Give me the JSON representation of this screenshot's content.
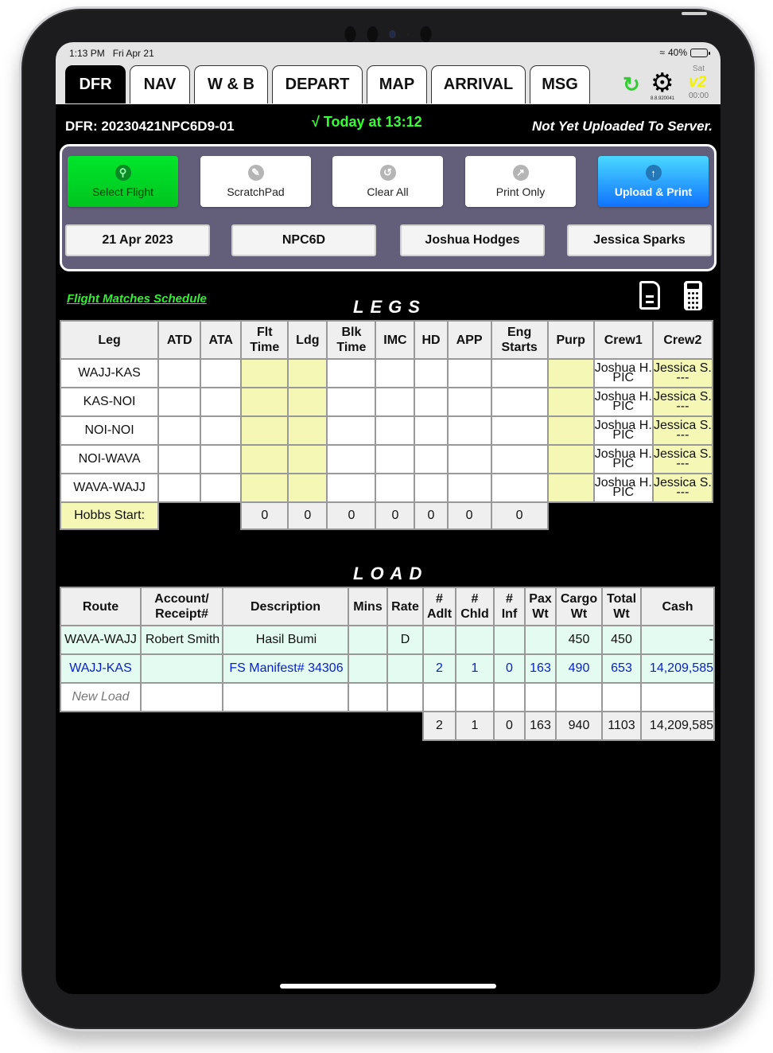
{
  "status_bar": {
    "time": "1:13 PM",
    "date": "Fri Apr 21",
    "battery": "40%",
    "battery_level": 0.4
  },
  "tabs": [
    {
      "label": "DFR",
      "active": true
    },
    {
      "label": "NAV"
    },
    {
      "label": "W & B"
    },
    {
      "label": "DEPART"
    },
    {
      "label": "MAP"
    },
    {
      "label": "ARRIVAL"
    },
    {
      "label": "MSG"
    }
  ],
  "toolbar": {
    "version": "8.8.920041",
    "day": "Sat",
    "badge": "v2",
    "clock": "00:00"
  },
  "info": {
    "dfr_id": "DFR: 20230421NPC6D9-01",
    "today": "√ Today at 13:12",
    "upload_status": "Not Yet Uploaded To Server."
  },
  "commands": [
    {
      "label": "Select Flight",
      "icon": "search-icon"
    },
    {
      "label": "ScratchPad",
      "icon": "pencil-icon"
    },
    {
      "label": "Clear All",
      "icon": "undo-icon"
    },
    {
      "label": "Print Only",
      "icon": "share-icon"
    },
    {
      "label": "Upload & Print",
      "icon": "upload-arrow-icon"
    }
  ],
  "fields": {
    "date": "21 Apr 2023",
    "aircraft": "NPC6D",
    "crew1": "Joshua Hodges",
    "crew2": "Jessica Sparks"
  },
  "schedule_link": "Flight Matches Schedule",
  "legs": {
    "title": "LEGS",
    "headers": [
      "Leg",
      "ATD",
      "ATA",
      "Flt\nTime",
      "Ldg",
      "Blk\nTime",
      "IMC",
      "HD",
      "APP",
      "Eng\nStarts",
      "Purp",
      "Crew1",
      "Crew2"
    ],
    "rows": [
      {
        "leg": "WAJJ-KAS",
        "crew1_name": "Joshua H.",
        "crew1_role": "PIC",
        "crew2_name": "Jessica S.",
        "crew2_role": "---"
      },
      {
        "leg": "KAS-NOI",
        "crew1_name": "Joshua H.",
        "crew1_role": "PIC",
        "crew2_name": "Jessica S.",
        "crew2_role": "---"
      },
      {
        "leg": "NOI-NOI",
        "crew1_name": "Joshua H.",
        "crew1_role": "PIC",
        "crew2_name": "Jessica S.",
        "crew2_role": "---"
      },
      {
        "leg": "NOI-WAVA",
        "crew1_name": "Joshua H.",
        "crew1_role": "PIC",
        "crew2_name": "Jessica S.",
        "crew2_role": "---"
      },
      {
        "leg": "WAVA-WAJJ",
        "crew1_name": "Joshua H.",
        "crew1_role": "PIC",
        "crew2_name": "Jessica S.",
        "crew2_role": "---"
      }
    ],
    "hobbs_label": "Hobbs Start:",
    "totals": [
      "0",
      "0",
      "0",
      "0",
      "0",
      "0",
      "0"
    ]
  },
  "load": {
    "title": "LOAD",
    "headers": [
      "Route",
      "Account/\nReceipt#",
      "Description",
      "Mins",
      "Rate",
      "#\nAdlt",
      "#\nChld",
      "#\nInf",
      "Pax\nWt",
      "Cargo\nWt",
      "Total\nWt",
      "Cash"
    ],
    "rows": [
      {
        "route": "WAVA-WAJJ",
        "account": "Robert Smith",
        "description": "Hasil Bumi",
        "mins": "",
        "rate": "D",
        "adlt": "",
        "chld": "",
        "inf": "",
        "pax_wt": "",
        "cargo_wt": "450",
        "total_wt": "450",
        "cash": "-"
      },
      {
        "route": "WAJJ-KAS",
        "account": "",
        "description": "FS Manifest# 34306",
        "mins": "",
        "rate": "",
        "adlt": "2",
        "chld": "1",
        "inf": "0",
        "pax_wt": "163",
        "cargo_wt": "490",
        "total_wt": "653",
        "cash": "14,209,585"
      }
    ],
    "new_load": "New Load",
    "totals": {
      "adlt": "2",
      "chld": "1",
      "inf": "0",
      "pax_wt": "163",
      "cargo_wt": "940",
      "total_wt": "1103",
      "cash": "14,209,585"
    }
  }
}
